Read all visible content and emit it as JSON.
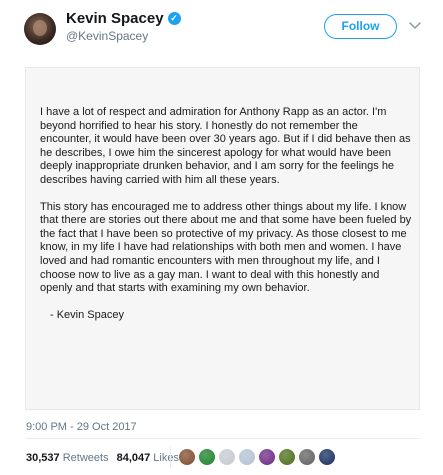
{
  "user": {
    "display_name": "Kevin Spacey",
    "handle": "@KevinSpacey",
    "verified_badge": "✓"
  },
  "follow_button": {
    "label": "Follow"
  },
  "statement": {
    "paragraphs": [
      "I have a lot of respect and admiration for Anthony Rapp as an actor. I'm beyond horrified to hear his story. I honestly do not remember the encounter, it would have been over 30 years ago. But if I did behave then as he describes, I owe him the sincerest apology for what would have been deeply inappropriate drunken behavior, and I am sorry for the feelings he describes having carried with him all these years.",
      "This story has encouraged me to address other things about my life. I know that there are stories out there about me and that some have been fueled by the fact that I have been so protective of my privacy. As those closest to me know, in my life I have had relationships with both men and women. I have loved and had romantic encounters with men throughout my life, and I choose now to live as a gay man. I want to deal with this honestly and openly and that starts with examining my own behavior."
    ],
    "signature": "- Kevin Spacey"
  },
  "timestamp": "9:00 PM - 29 Oct 2017",
  "stats": {
    "retweets_count": "30,537",
    "retweets_label": "Retweets",
    "likes_count": "84,047",
    "likes_label": "Likes"
  },
  "colors": {
    "accent": "#1da1f2",
    "liker_avatars": [
      "#8b5a3c",
      "#2e8b3d",
      "#c9ced3",
      "#b9c6d6",
      "#7a3b8f",
      "#5b7a2c",
      "#6e6e6e",
      "#2a3f6b"
    ]
  }
}
